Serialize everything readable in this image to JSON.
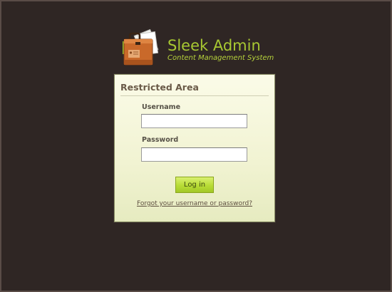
{
  "app": {
    "title": "Sleek Admin",
    "subtitle": "Content Management System"
  },
  "login_panel": {
    "title": "Restricted Area",
    "username_label": "Username",
    "username_value": "",
    "password_label": "Password",
    "password_value": "",
    "submit_label": "Log in",
    "forgot_link": "Forgot your username or password?"
  },
  "colors": {
    "page_background": "#2f2624",
    "brand_green": "#a8c832",
    "panel_background": "#f4f5d8",
    "button_green": "#b8dc36"
  },
  "icons": {
    "logo": "briefcase-icon"
  }
}
